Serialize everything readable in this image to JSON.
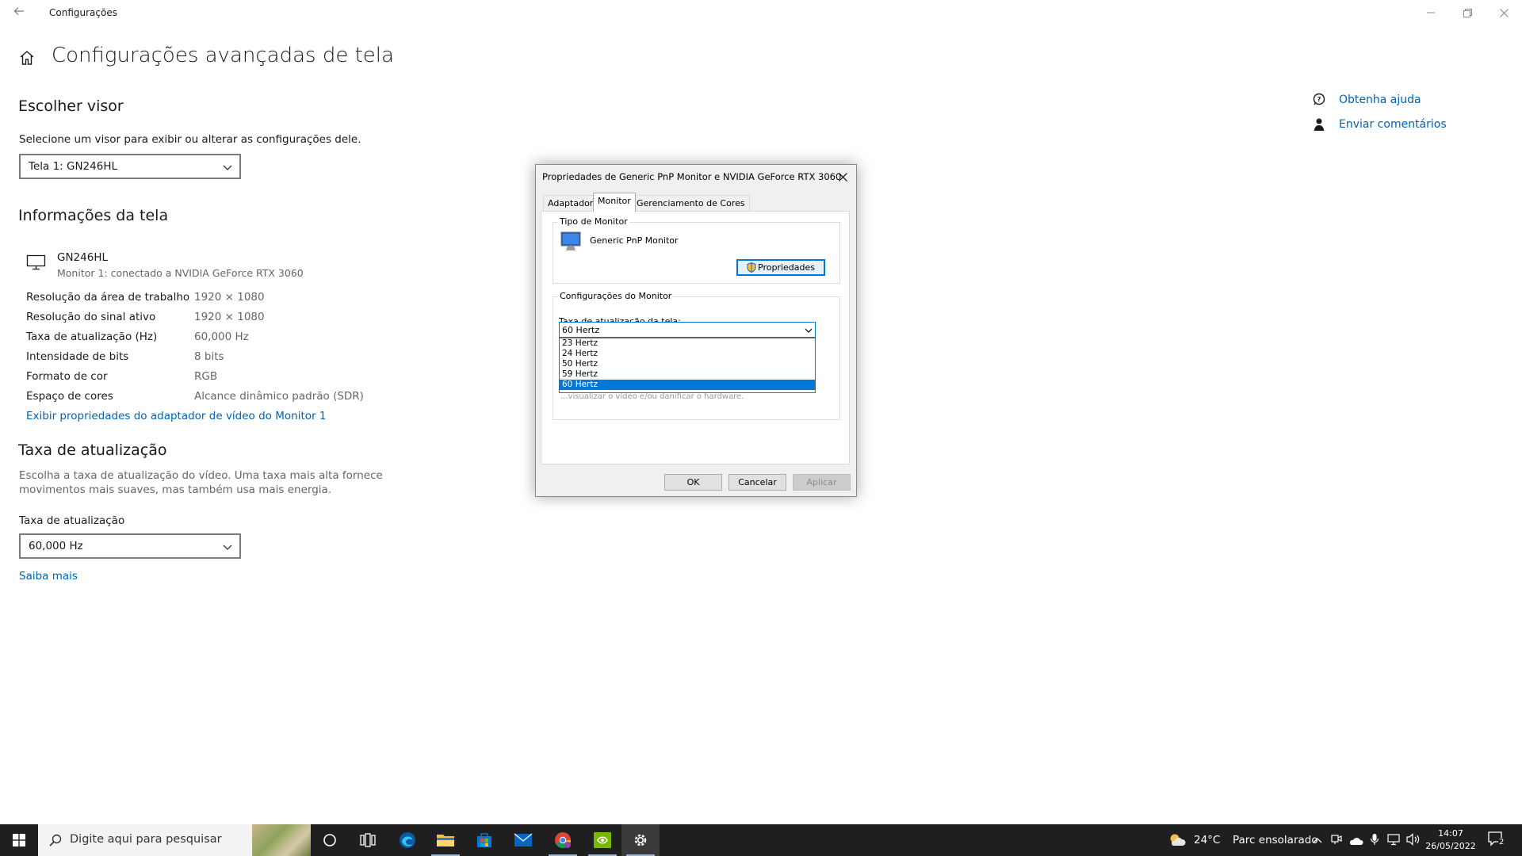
{
  "window": {
    "title": "Configurações",
    "back_icon": "back-arrow-icon",
    "controls": [
      "minimize-icon",
      "restore-icon",
      "close-icon"
    ]
  },
  "page": {
    "title": "Configurações avançadas de tela",
    "home_icon": "home-icon"
  },
  "choose_display": {
    "heading": "Escolher visor",
    "instruction": "Selecione um visor para exibir ou alterar as configurações dele.",
    "selected": "Tela 1: GN246HL"
  },
  "display_info": {
    "heading": "Informações da tela",
    "monitor_name": "GN246HL",
    "monitor_subtitle": "Monitor 1: conectado a NVIDIA GeForce RTX 3060",
    "rows": [
      {
        "label": "Resolução da área de trabalho",
        "value": "1920 × 1080"
      },
      {
        "label": "Resolução do sinal ativo",
        "value": "1920 × 1080"
      },
      {
        "label": "Taxa de atualização (Hz)",
        "value": "60,000 Hz"
      },
      {
        "label": "Intensidade de bits",
        "value": "8 bits"
      },
      {
        "label": "Formato de cor",
        "value": "RGB"
      },
      {
        "label": "Espaço de cores",
        "value": "Alcance dinâmico padrão (SDR)"
      }
    ],
    "adapter_link": "Exibir propriedades do adaptador de vídeo do Monitor 1"
  },
  "refresh": {
    "heading": "Taxa de atualização",
    "desc_line1": "Escolha a taxa de atualização do vídeo. Uma taxa mais alta fornece",
    "desc_line2": "movimentos mais suaves, mas também usa mais energia.",
    "label": "Taxa de atualização",
    "selected": "60,000 Hz",
    "learn_more": "Saiba mais"
  },
  "help": {
    "get_help": "Obtenha ajuda",
    "feedback": "Enviar comentários"
  },
  "dialog": {
    "title": "Propriedades de Generic PnP Monitor e NVIDIA GeForce RTX 3060",
    "tabs": [
      "Adaptador",
      "Monitor",
      "Gerenciamento de Cores"
    ],
    "active_tab": "Monitor",
    "monitor_type_group": "Tipo de Monitor",
    "monitor_type_name": "Generic PnP Monitor",
    "properties_button": "Propriedades",
    "settings_group": "Configurações do Monitor",
    "refresh_label": "Taxa de atualização da tela:",
    "refresh_selected": "60 Hertz",
    "refresh_options": [
      "23 Hertz",
      "24 Hertz",
      "50 Hertz",
      "59 Hertz",
      "60 Hertz"
    ],
    "hidden_text_fragment": "...visualizar o vídeo e/ou danificar o hardware.",
    "ok": "OK",
    "cancel": "Cancelar",
    "apply": "Aplicar"
  },
  "taskbar": {
    "search_placeholder": "Digite aqui para pesquisar",
    "apps": [
      "cortana-icon",
      "task-view-icon",
      "edge-icon",
      "file-explorer-icon",
      "store-icon",
      "mail-icon",
      "chrome-icon",
      "nvidia-icon",
      "settings-icon"
    ],
    "weather_temp": "24°C",
    "weather_desc": "Parc ensolarado",
    "time": "14:07",
    "date": "26/05/2022",
    "notifications_count": "2"
  },
  "colors": {
    "accent": "#0078d7",
    "link": "#0063b1",
    "taskbar": "#1f1f1f"
  }
}
